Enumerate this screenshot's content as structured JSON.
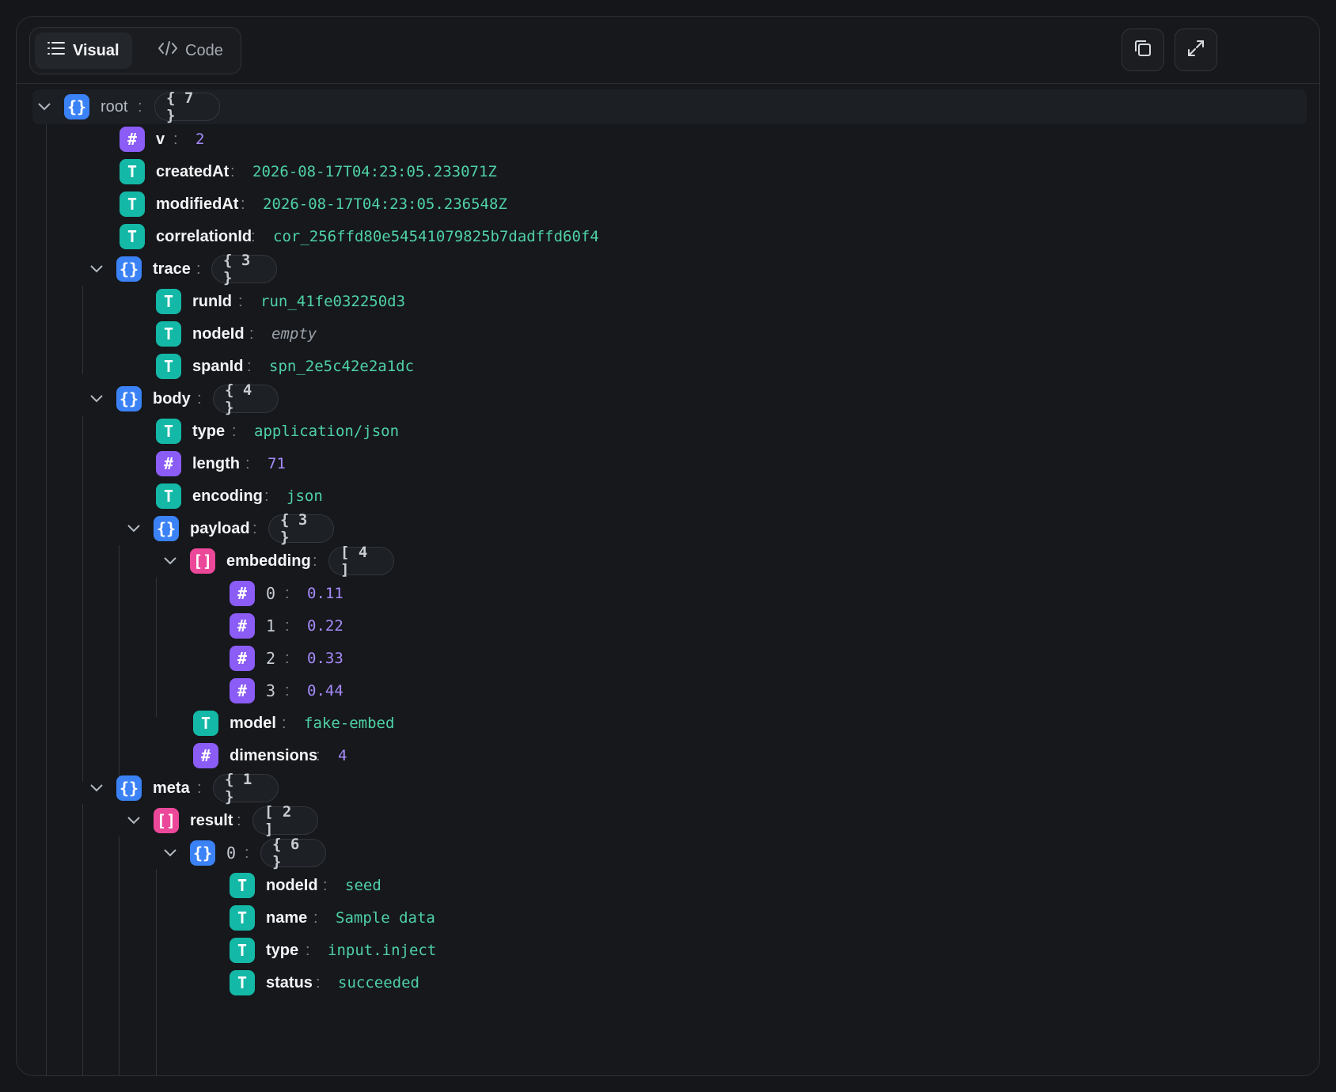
{
  "toolbar": {
    "tab_visual": "Visual",
    "tab_code": "Code",
    "active_tab": "Visual",
    "copy_icon": "copy-icon",
    "expand_icon": "expand-icon"
  },
  "colors": {
    "object": "#3b82f6",
    "array": "#ec4899",
    "number": "#8b5cf6",
    "string": "#14b8a6"
  },
  "tree": {
    "root": {
      "key": "root",
      "count": "{ 7 }"
    },
    "v": {
      "key": "v",
      "value": "2"
    },
    "createdAt": {
      "key": "createdAt",
      "value": "2026-08-17T04:23:05.233071Z"
    },
    "modifiedAt": {
      "key": "modifiedAt",
      "value": "2026-08-17T04:23:05.236548Z"
    },
    "correlationId": {
      "key": "correlationId",
      "value": "cor_256ffd80e54541079825b7dadffd60f4"
    },
    "trace": {
      "key": "trace",
      "count": "{ 3 }",
      "runId": {
        "key": "runId",
        "value": "run_41fe032250d3"
      },
      "nodeId": {
        "key": "nodeId",
        "value": "empty"
      },
      "spanId": {
        "key": "spanId",
        "value": "spn_2e5c42e2a1dc"
      }
    },
    "body": {
      "key": "body",
      "count": "{ 4 }",
      "type": {
        "key": "type",
        "value": "application/json"
      },
      "length": {
        "key": "length",
        "value": "71"
      },
      "encoding": {
        "key": "encoding",
        "value": "json"
      },
      "payload": {
        "key": "payload",
        "count": "{ 3 }",
        "embedding": {
          "key": "embedding",
          "count": "[ 4 ]",
          "items": [
            {
              "key": "0",
              "value": "0.11"
            },
            {
              "key": "1",
              "value": "0.22"
            },
            {
              "key": "2",
              "value": "0.33"
            },
            {
              "key": "3",
              "value": "0.44"
            }
          ]
        },
        "model": {
          "key": "model",
          "value": "fake-embed"
        },
        "dimensions": {
          "key": "dimensions",
          "value": "4"
        }
      }
    },
    "meta": {
      "key": "meta",
      "count": "{ 1 }",
      "result": {
        "key": "result",
        "count": "[ 2 ]",
        "item0": {
          "key": "0",
          "count": "{ 6 }",
          "nodeId": {
            "key": "nodeId",
            "value": "seed"
          },
          "name": {
            "key": "name",
            "value": "Sample data"
          },
          "type": {
            "key": "type",
            "value": "input.inject"
          },
          "status": {
            "key": "status",
            "value": "succeeded"
          }
        }
      }
    }
  }
}
